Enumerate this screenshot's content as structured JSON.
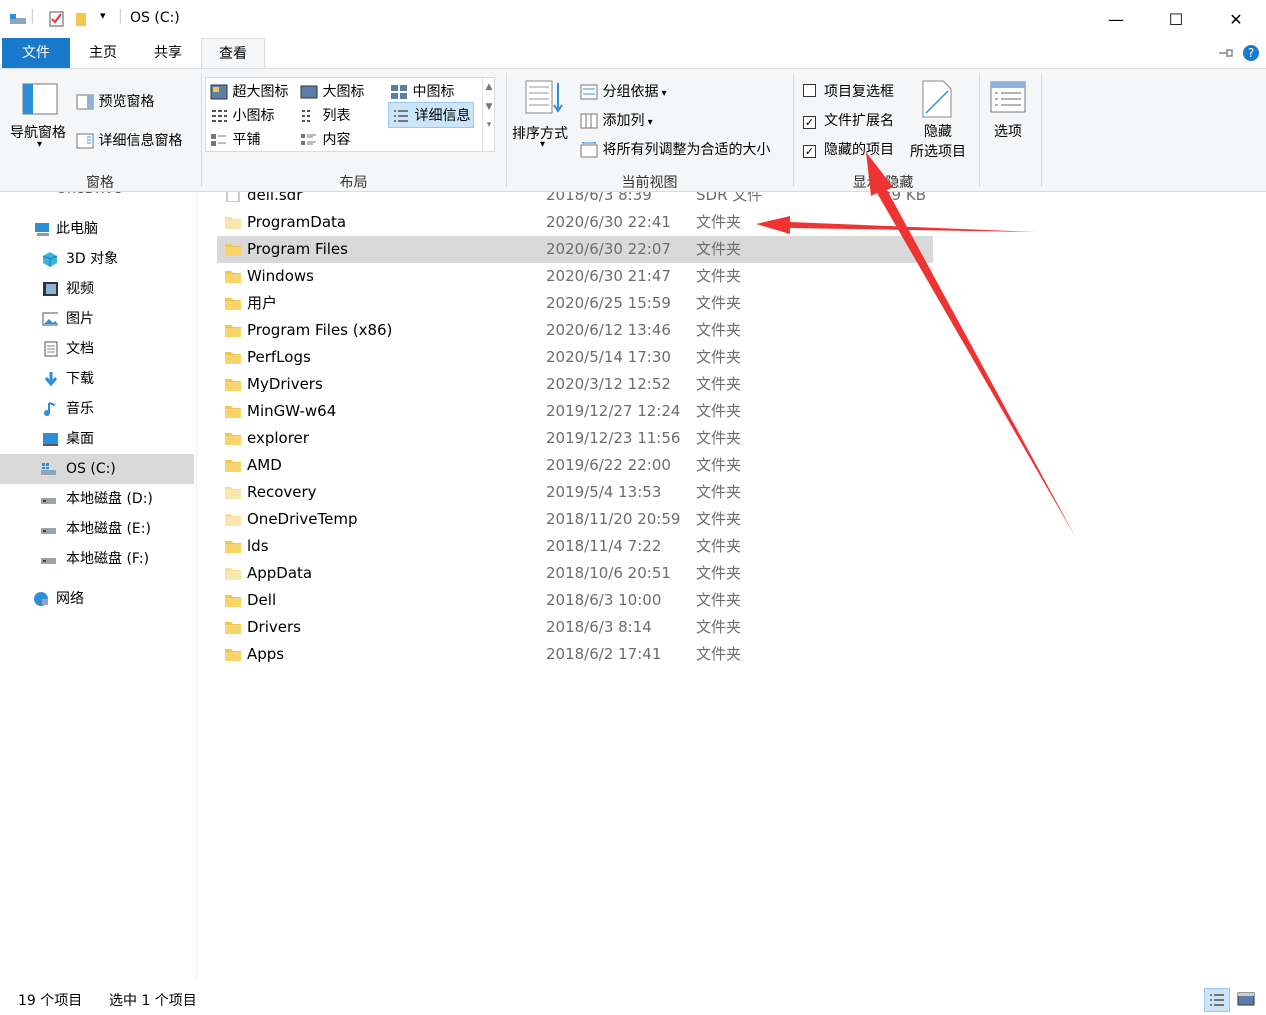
{
  "window": {
    "title": "OS (C:)",
    "minimize_glyph": "—",
    "maximize_glyph": "☐",
    "close_glyph": "✕"
  },
  "tabs": [
    {
      "label": "文件"
    },
    {
      "label": "主页"
    },
    {
      "label": "共享"
    },
    {
      "label": "查看"
    }
  ],
  "ribbon": {
    "panes": {
      "nav_pane": "导航窗格",
      "preview_pane": "预览窗格",
      "details_pane": "详细信息窗格",
      "group_label": "窗格"
    },
    "layout": {
      "items": [
        "超大图标",
        "大图标",
        "中图标",
        "小图标",
        "列表",
        "详细信息",
        "平铺",
        "内容"
      ],
      "group_label": "布局"
    },
    "current_view": {
      "sort_by": "排序方式",
      "group_by": "分组依据",
      "add_columns": "添加列",
      "size_columns": "将所有列调整为合适的大小",
      "group_label": "当前视图"
    },
    "show_hide": {
      "item_checkboxes": "项目复选框",
      "file_extensions": "文件扩展名",
      "hidden_items": "隐藏的项目",
      "hide_selected_1": "隐藏",
      "hide_selected_2": "所选项目",
      "group_label": "显示/隐藏",
      "item_checkboxes_checked": false,
      "file_extensions_checked": true,
      "hidden_items_checked": true
    },
    "options": "选项"
  },
  "nav": {
    "cutoff_label": "OneDrive",
    "items": [
      {
        "label": "此电脑",
        "icon": "pc-icon"
      },
      {
        "label": "3D 对象",
        "icon": "cube-icon"
      },
      {
        "label": "视频",
        "icon": "film-icon"
      },
      {
        "label": "图片",
        "icon": "picture-icon"
      },
      {
        "label": "文档",
        "icon": "document-icon"
      },
      {
        "label": "下载",
        "icon": "download-icon"
      },
      {
        "label": "音乐",
        "icon": "music-icon"
      },
      {
        "label": "桌面",
        "icon": "desktop-icon"
      },
      {
        "label": "OS (C:)",
        "icon": "windows-drive-icon"
      },
      {
        "label": "本地磁盘 (D:)",
        "icon": "drive-icon"
      },
      {
        "label": "本地磁盘 (E:)",
        "icon": "drive-icon"
      },
      {
        "label": "本地磁盘 (F:)",
        "icon": "drive-icon"
      },
      {
        "label": "网络",
        "icon": "network-icon"
      }
    ]
  },
  "files": {
    "partial_row": {
      "name": "dell.sdr",
      "date": "2018/6/3 8:39",
      "type": "SDR 文件",
      "size": "29 KB"
    },
    "rows": [
      {
        "name": "ProgramData",
        "date": "2020/6/30 22:41",
        "type": "文件夹",
        "faded": true
      },
      {
        "name": "Program Files",
        "date": "2020/6/30 22:07",
        "type": "文件夹",
        "selected": true
      },
      {
        "name": "Windows",
        "date": "2020/6/30 21:47",
        "type": "文件夹"
      },
      {
        "name": "用户",
        "date": "2020/6/25 15:59",
        "type": "文件夹"
      },
      {
        "name": "Program Files (x86)",
        "date": "2020/6/12 13:46",
        "type": "文件夹"
      },
      {
        "name": "PerfLogs",
        "date": "2020/5/14 17:30",
        "type": "文件夹"
      },
      {
        "name": "MyDrivers",
        "date": "2020/3/12 12:52",
        "type": "文件夹"
      },
      {
        "name": "MinGW-w64",
        "date": "2019/12/27 12:24",
        "type": "文件夹"
      },
      {
        "name": "explorer",
        "date": "2019/12/23 11:56",
        "type": "文件夹"
      },
      {
        "name": "AMD",
        "date": "2019/6/22 22:00",
        "type": "文件夹"
      },
      {
        "name": "Recovery",
        "date": "2019/5/4 13:53",
        "type": "文件夹",
        "faded": true
      },
      {
        "name": "OneDriveTemp",
        "date": "2018/11/20 20:59",
        "type": "文件夹",
        "faded": true
      },
      {
        "name": "lds",
        "date": "2018/11/4 7:22",
        "type": "文件夹"
      },
      {
        "name": "AppData",
        "date": "2018/10/6 20:51",
        "type": "文件夹",
        "faded": true
      },
      {
        "name": "Dell",
        "date": "2018/6/3 10:00",
        "type": "文件夹"
      },
      {
        "name": "Drivers",
        "date": "2018/6/3 8:14",
        "type": "文件夹"
      },
      {
        "name": "Apps",
        "date": "2018/6/2 17:41",
        "type": "文件夹"
      }
    ]
  },
  "status": {
    "count": "19 个项目",
    "selected": "选中 1 个项目"
  },
  "colors": {
    "accent": "#1979ca",
    "arrow": "#ee3333",
    "folder": "#f4c54d"
  }
}
